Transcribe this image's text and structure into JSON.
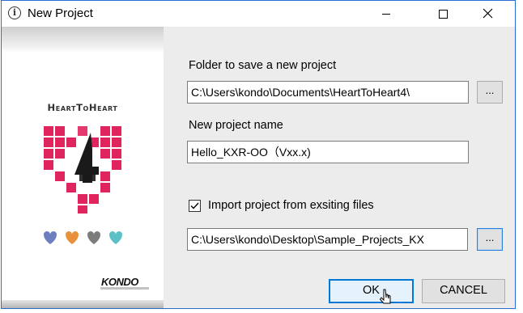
{
  "window": {
    "title": "New Project",
    "accent_color": "#2b6cd6"
  },
  "titlebar_icons": [
    "info-icon",
    "minimize-icon",
    "maximize-icon",
    "close-icon"
  ],
  "brand": {
    "title": "HeartToHeart",
    "logo": "heart-4-logo",
    "vendor": "KONDO"
  },
  "form": {
    "folder_label": "Folder to save a new project",
    "folder_value": "C:\\Users\\kondo\\Documents\\HeartToHeart4\\",
    "folder_browse": "...",
    "name_label": "New project name",
    "name_value": "Hello_KXR-OO（Vxx.x)",
    "import_checked": true,
    "import_label": "Import project from exsiting files",
    "import_value": "C:\\Users\\kondo\\Desktop\\Sample_Projects_KX",
    "import_browse": "..."
  },
  "buttons": {
    "ok": "OK",
    "cancel": "CANCEL"
  }
}
